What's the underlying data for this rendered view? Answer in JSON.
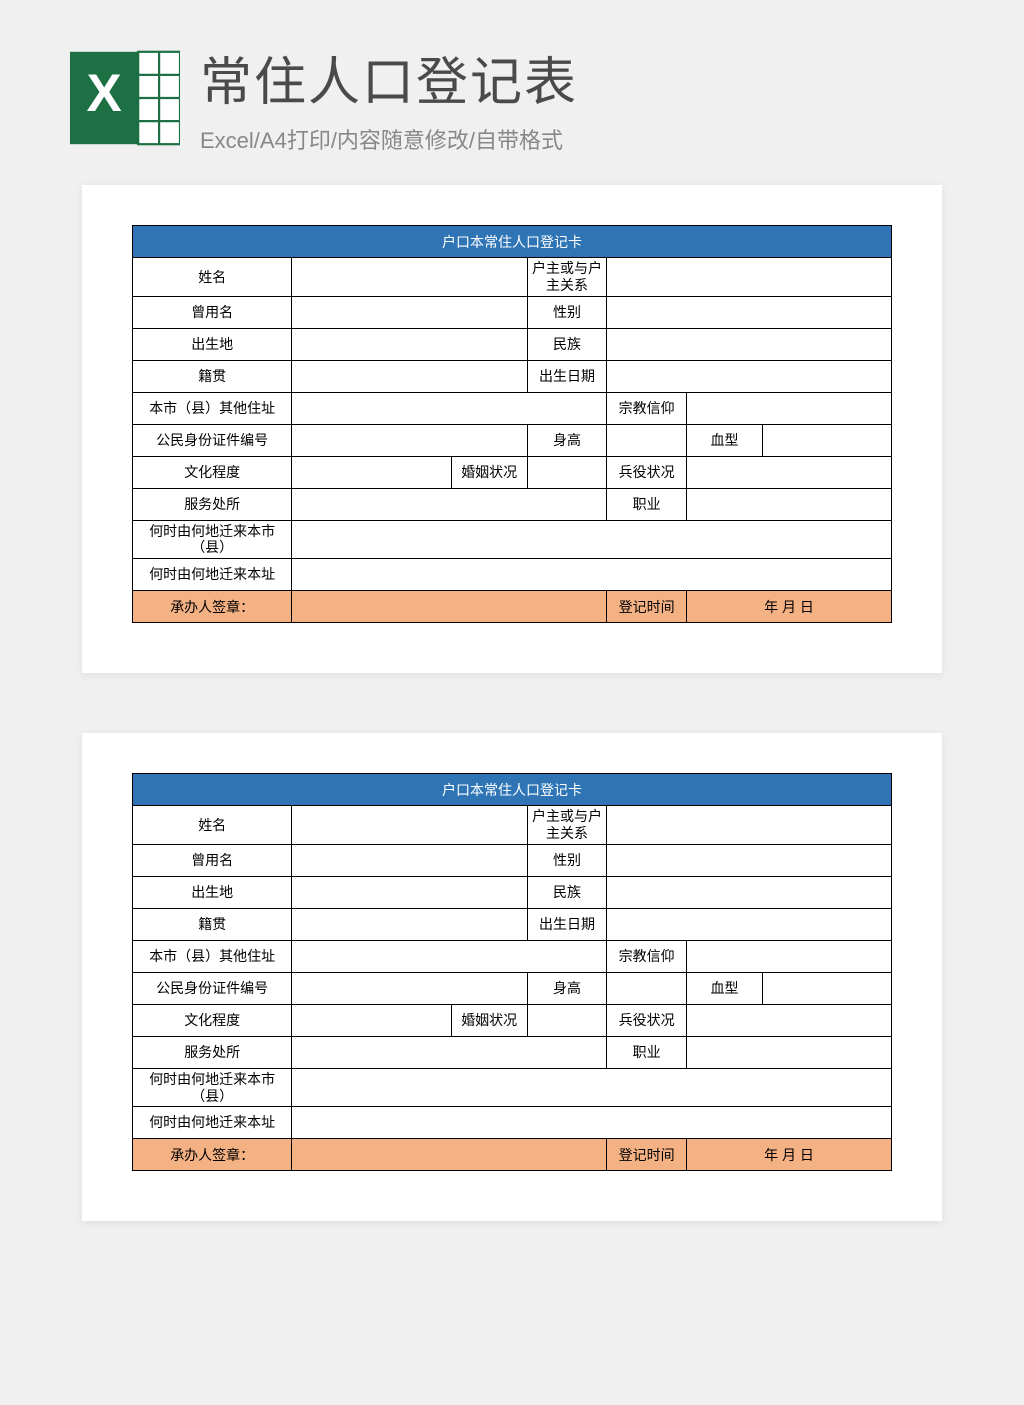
{
  "header": {
    "title": "常住人口登记表",
    "subtitle": "Excel/A4打印/内容随意修改/自带格式",
    "icon_letters": "X",
    "icon_grid": "▦"
  },
  "form": {
    "table_title": "户口本常住人口登记卡",
    "name": "姓名",
    "relation": "户主或与户主关系",
    "former_name": "曾用名",
    "sex": "性别",
    "birthplace": "出生地",
    "ethnicity": "民族",
    "ancestral": "籍贯",
    "dob": "出生日期",
    "other_addr": "本市（县）其他住址",
    "religion": "宗教信仰",
    "id_number": "公民身份证件编号",
    "height": "身高",
    "blood": "血型",
    "education": "文化程度",
    "marital": "婚姻状况",
    "military": "兵役状况",
    "workplace": "服务处所",
    "occupation": "职业",
    "migrate_city": "何时由何地迁来本市（县）",
    "migrate_addr": "何时由何地迁来本址",
    "handler": "承办人签章：",
    "reg_time": "登记时间",
    "date_fmt": "年  月  日"
  }
}
